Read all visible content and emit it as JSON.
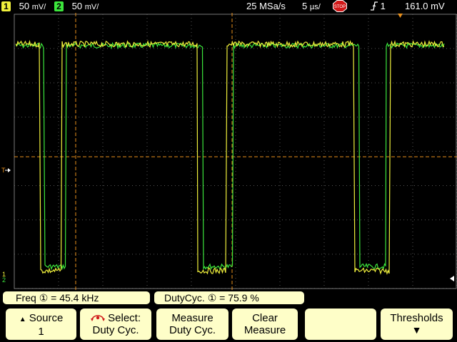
{
  "top_bar": {
    "ch1_number": "1",
    "ch1_scale": "50",
    "ch1_unit": "mV/",
    "ch2_number": "2",
    "ch2_scale": "50",
    "ch2_unit": "mV/",
    "sample_rate": "25 MSa/s",
    "timebase": "5",
    "timebase_unit": "µs/",
    "run_state": "STOP",
    "trigger_source": "1",
    "trigger_level": "161.0 mV"
  },
  "colors": {
    "ch1": "#f0f03c",
    "ch2": "#3ce63c",
    "grid": "#5a5a5a",
    "cursor": "#e8901c",
    "panel": "#fefec8"
  },
  "measurements": {
    "freq_label": "Freq",
    "freq_channel": "①",
    "freq_value": "= 45.4 kHz",
    "duty_label": "DutyCyc.",
    "duty_channel": "①",
    "duty_value": "= 75.9 %"
  },
  "softkeys": {
    "source_label": "Source",
    "source_value": "1",
    "select_label": "Select:",
    "select_value": "Duty Cyc.",
    "measure_label": "Measure",
    "measure_value": "Duty Cyc.",
    "clear_label": "Clear",
    "clear_value": "Measure",
    "blank_label": "",
    "thresholds_label": "Thresholds"
  }
}
